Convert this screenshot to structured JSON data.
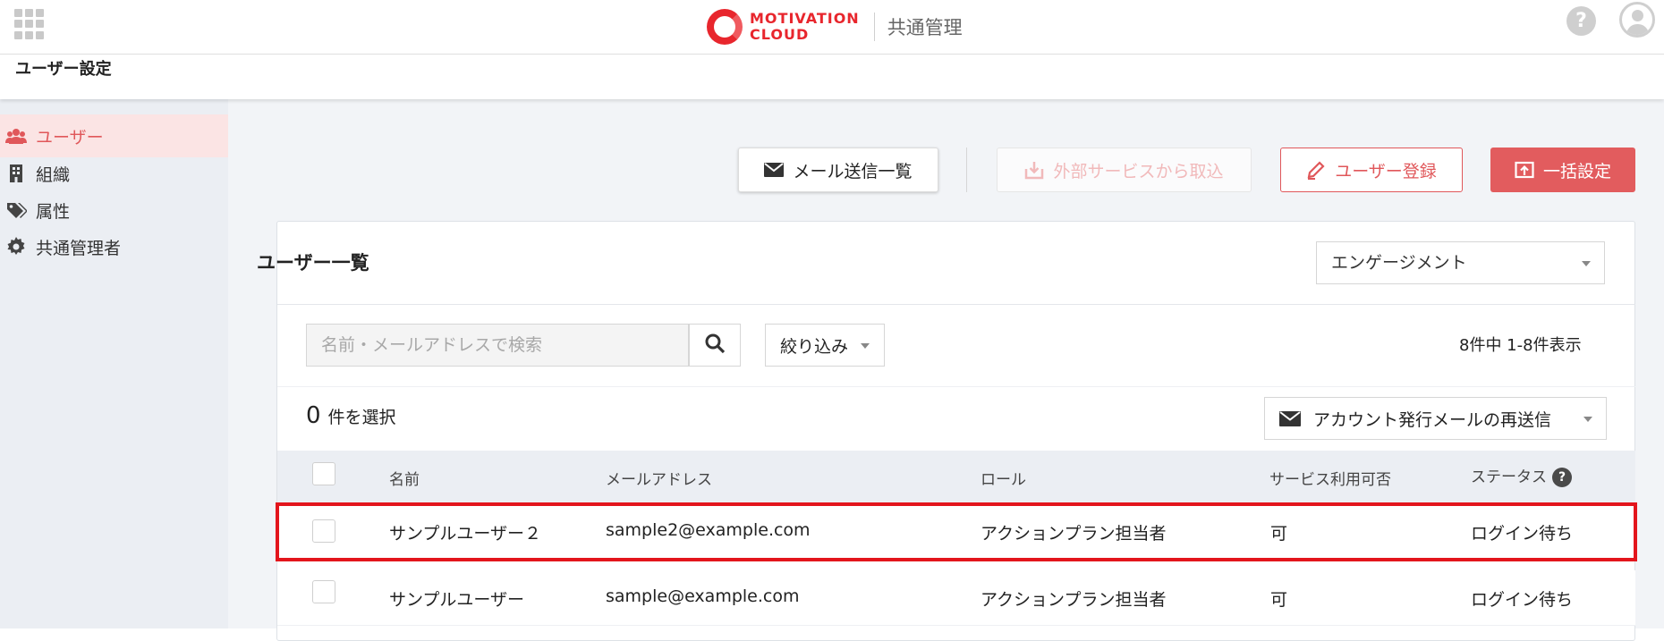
{
  "topbar": {
    "brand_line1": "MOTIVATION",
    "brand_line2": "CLOUD",
    "brand_sub": "共通管理",
    "help_glyph": "?",
    "accent": "#e8262d"
  },
  "page": {
    "title": "ユーザー設定"
  },
  "sidebar": {
    "items": [
      {
        "label": "ユーザー",
        "icon": "users-icon",
        "active": true
      },
      {
        "label": "組織",
        "icon": "building-icon",
        "active": false
      },
      {
        "label": "属性",
        "icon": "tags-icon",
        "active": false
      },
      {
        "label": "共通管理者",
        "icon": "gear-icon",
        "active": false
      }
    ]
  },
  "toolbar": {
    "mail_list_label": "メール送信一覧",
    "import_label": "外部サービスから取込",
    "register_label": "ユーザー登録",
    "bulk_label": "一括設定"
  },
  "panel": {
    "title": "ユーザー一覧",
    "engagement_select": "エンゲージメント",
    "search_placeholder": "名前・メールアドレスで検索",
    "filter_label": "絞り込み",
    "count_text": "8件中 1-8件表示",
    "selected_count": "0",
    "selected_suffix": "件を選択",
    "resend_label": "アカウント発行メールの再送信"
  },
  "table": {
    "columns": [
      "名前",
      "メールアドレス",
      "ロール",
      "サービス利用可否",
      "ステータス"
    ],
    "rows": [
      {
        "name": "サンプルユーザー２",
        "email": "sample2@example.com",
        "role": "アクションプラン担当者",
        "service": "可",
        "status": "ログイン待ち",
        "highlighted": true
      },
      {
        "name": "サンプルユーザー",
        "email": "sample@example.com",
        "role": "アクションプラン担当者",
        "service": "可",
        "status": "ログイン待ち",
        "highlighted": false
      }
    ]
  },
  "colors": {
    "primary": "#e25c5e",
    "sidebar_bg": "#ebeef3",
    "highlight_border": "#e3151c"
  }
}
